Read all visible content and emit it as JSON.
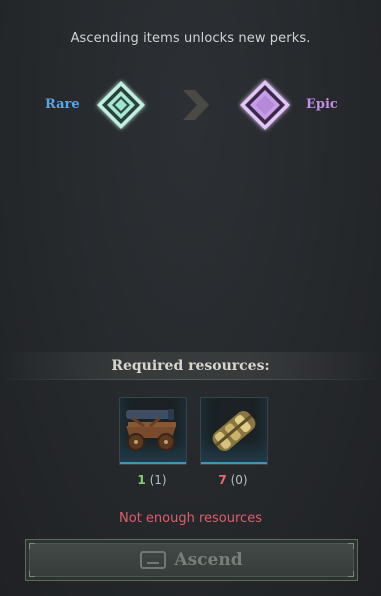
{
  "header": {
    "text": "Ascending items unlocks new perks."
  },
  "rarity": {
    "from": {
      "label": "Rare",
      "color": "#58a6e8",
      "icon": "rare-diamond-icon"
    },
    "to": {
      "label": "Epic",
      "color": "#c28ee6",
      "icon": "epic-diamond-icon"
    },
    "arrow_icon": "chevron-right-icon"
  },
  "requirements": {
    "title": "Required resources:",
    "items": [
      {
        "icon": "siege-cart-icon",
        "needed": "1",
        "owned": "(1)",
        "status": "enough"
      },
      {
        "icon": "gold-ore-bundle-icon",
        "needed": "7",
        "owned": "(0)",
        "status": "insufficient"
      }
    ]
  },
  "warning": "Not enough resources",
  "ascend_button": {
    "label": "Ascend",
    "key_icon": "spacebar-key-icon",
    "enabled": false
  }
}
